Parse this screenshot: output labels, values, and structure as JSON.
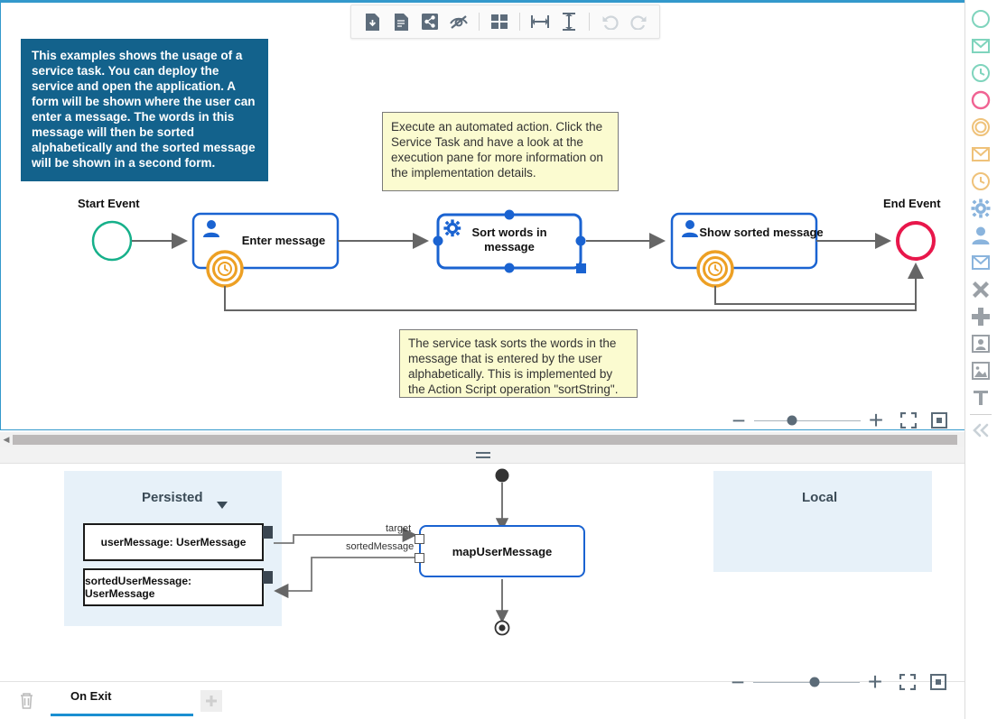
{
  "toolbar": {
    "buttons": [
      {
        "name": "download-file-icon",
        "label": "Download"
      },
      {
        "name": "document-icon",
        "label": "Documentation"
      },
      {
        "name": "share-icon",
        "label": "Share"
      },
      {
        "name": "eye-hidden-icon",
        "label": "Hide"
      },
      {
        "name": "grid-layout-icon",
        "label": "Layout"
      },
      {
        "name": "horizontal-spacing-icon",
        "label": "Distribute Horizontally"
      },
      {
        "name": "vertical-spacing-icon",
        "label": "Distribute Vertically"
      },
      {
        "name": "undo-icon",
        "label": "Undo"
      },
      {
        "name": "redo-icon",
        "label": "Redo"
      }
    ]
  },
  "notes": {
    "blue": "This examples shows the usage of a service task. You can deploy the service and open the application. A form will be shown where the user can enter a message. The words in this message will then be sorted alphabetically and the sorted message will be shown in a second form.",
    "yellow_top": "Execute an automated action. Click the Service Task and have a look at the execution pane for more information on the implementation details.",
    "yellow_bottom": "The service task sorts the words in the message that is entered by the user alphabetically. This is implemented by the Action Script operation \"sortString\"."
  },
  "diagram": {
    "start_event_label": "Start Event",
    "end_event_label": "End Event",
    "tasks": [
      {
        "name": "task-enter-message",
        "label": "Enter message",
        "type": "user-task",
        "selected": false,
        "boundary": "timer"
      },
      {
        "name": "task-sort-words",
        "label": "Sort words in message",
        "type": "service-task",
        "selected": true,
        "boundary": "none"
      },
      {
        "name": "task-show-sorted",
        "label": "Show sorted message",
        "type": "user-task",
        "selected": false,
        "boundary": "timer"
      }
    ],
    "colors": {
      "start_event": "#16b08a",
      "end_event": "#e8174b",
      "task_border": "#1a63d1",
      "boundary_event": "#eda024",
      "connector": "#666666",
      "selection": "#1a63d1"
    }
  },
  "zoom_top": {
    "minus_label": "−",
    "plus_label": "+",
    "value_percent": 36,
    "fit_icon": "fit-screen-icon",
    "center_icon": "center-view-icon"
  },
  "zoom_bottom": {
    "minus_label": "−",
    "plus_label": "+",
    "value_percent": 58,
    "fit_icon": "fit-screen-icon",
    "center_icon": "center-view-icon"
  },
  "palette": {
    "items": [
      {
        "name": "start-event-palette-icon",
        "shape": "circle",
        "color": "#7fd4bd"
      },
      {
        "name": "message-start-event-palette-icon",
        "shape": "envelope",
        "color": "#7fd4bd"
      },
      {
        "name": "timer-start-event-palette-icon",
        "shape": "clock",
        "color": "#7fd4bd"
      },
      {
        "name": "end-event-palette-icon",
        "shape": "circle",
        "color": "#f06292"
      },
      {
        "name": "boundary-event-palette-icon",
        "shape": "double-circle",
        "color": "#efc27a"
      },
      {
        "name": "message-boundary-palette-icon",
        "shape": "envelope",
        "color": "#efc27a"
      },
      {
        "name": "timer-boundary-palette-icon",
        "shape": "clock",
        "color": "#efc27a"
      },
      {
        "name": "service-task-palette-icon",
        "shape": "gear",
        "color": "#8ab4dd"
      },
      {
        "name": "user-task-palette-icon",
        "shape": "person",
        "color": "#8ab4dd"
      },
      {
        "name": "message-task-palette-icon",
        "shape": "envelope",
        "color": "#8ab4dd"
      },
      {
        "name": "terminate-palette-icon",
        "shape": "x-cross",
        "color": "#9aa0a6"
      },
      {
        "name": "add-palette-icon",
        "shape": "plus",
        "color": "#9aa0a6"
      },
      {
        "name": "user-image-palette-icon",
        "shape": "person-frame",
        "color": "#9aa0a6"
      },
      {
        "name": "image-palette-icon",
        "shape": "picture",
        "color": "#9aa0a6"
      },
      {
        "name": "text-palette-icon",
        "shape": "text-T",
        "color": "#9aa0a6"
      }
    ],
    "collapse_icon": "collapse-left-icon"
  },
  "execution": {
    "scopes": [
      {
        "name": "scope-persisted",
        "title": "Persisted",
        "has_caret": true
      },
      {
        "name": "scope-local",
        "title": "Local",
        "has_caret": false
      }
    ],
    "data_nodes": [
      {
        "name": "data-node-usermessage",
        "label": "userMessage: UserMessage"
      },
      {
        "name": "data-node-sortedusermessage",
        "label": "sortedUserMessage: UserMessage"
      }
    ],
    "mapping_node": {
      "name": "mapping-node-mapusermessage",
      "label": "mapUserMessage"
    },
    "edge_labels": [
      "target",
      "sortedMessage"
    ]
  },
  "bottom_bar": {
    "trash_icon": "trash-icon",
    "active_tab": "On Exit",
    "add_icon": "plus-icon"
  }
}
